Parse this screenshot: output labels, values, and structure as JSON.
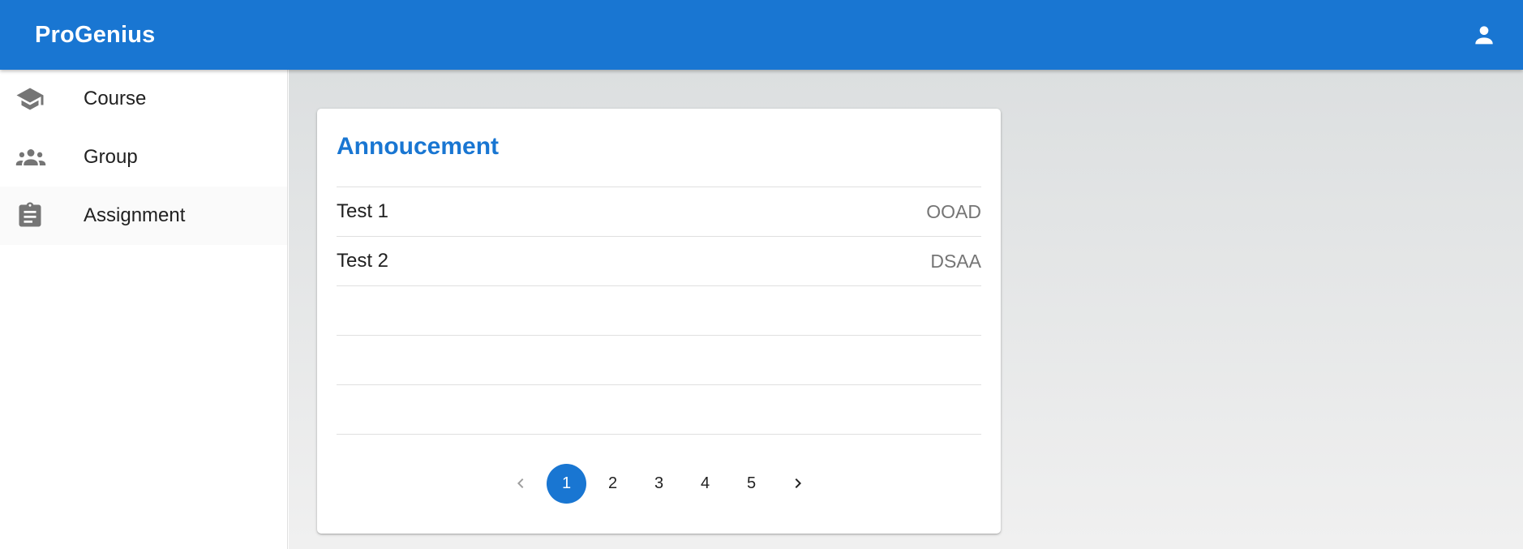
{
  "app": {
    "title": "ProGenius",
    "account_icon": "account-icon",
    "brand_color": "#1976d2"
  },
  "sidebar": {
    "items": [
      {
        "label": "Course",
        "icon": "school-icon",
        "active": false
      },
      {
        "label": "Group",
        "icon": "groups-icon",
        "active": false
      },
      {
        "label": "Assignment",
        "icon": "clipboard-icon",
        "active": true
      }
    ]
  },
  "announcement": {
    "title": "Annoucement",
    "rows": [
      {
        "title": "Test 1",
        "tag": "OOAD"
      },
      {
        "title": "Test 2",
        "tag": "DSAA"
      },
      {
        "title": "",
        "tag": ""
      },
      {
        "title": "",
        "tag": ""
      },
      {
        "title": "",
        "tag": ""
      }
    ],
    "pagination": {
      "current": 1,
      "pages": [
        "1",
        "2",
        "3",
        "4",
        "5"
      ],
      "prev_icon": "chevron-left-icon",
      "next_icon": "chevron-right-icon"
    }
  }
}
